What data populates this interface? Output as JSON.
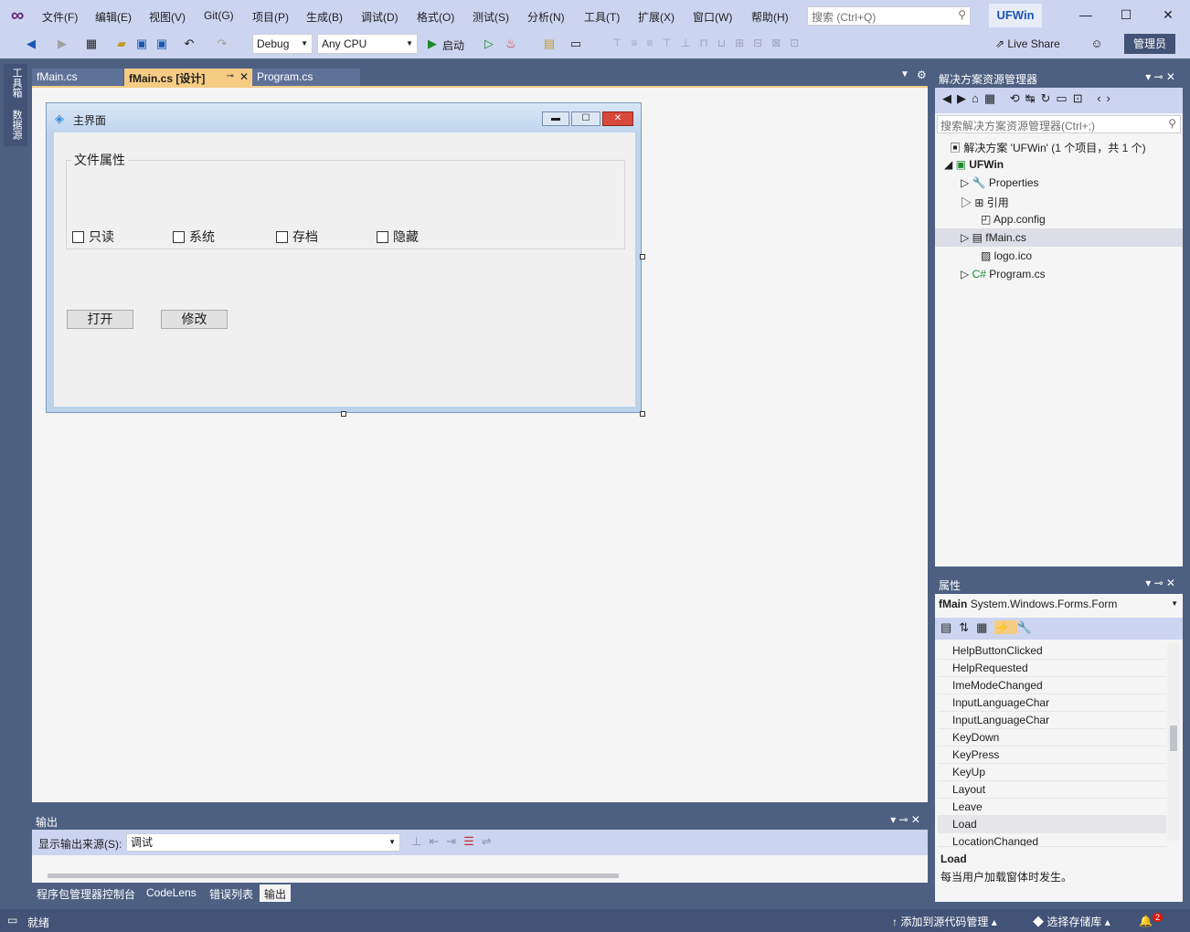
{
  "menu": [
    "文件(F)",
    "编辑(E)",
    "视图(V)",
    "Git(G)",
    "项目(P)",
    "生成(B)",
    "调试(D)",
    "格式(O)",
    "测试(S)",
    "分析(N)",
    "工具(T)",
    "扩展(X)",
    "窗口(W)",
    "帮助(H)"
  ],
  "search_placeholder": "搜索 (Ctrl+Q)",
  "app_title": "UFWin",
  "toolbar": {
    "config": "Debug",
    "platform": "Any CPU",
    "start": "启动",
    "live_share": "Live Share",
    "admin": "管理员"
  },
  "left_tabs": [
    "工具箱",
    "数据源"
  ],
  "doc_tabs": [
    "fMain.cs",
    "fMain.cs [设计]",
    "Program.cs"
  ],
  "form": {
    "title": "主界面",
    "group": "文件属性",
    "checkboxes": [
      "只读",
      "系统",
      "存档",
      "隐藏"
    ],
    "buttons": [
      "打开",
      "修改"
    ]
  },
  "solution": {
    "header": "解决方案资源管理器",
    "search": "搜索解决方案资源管理器(Ctrl+;)",
    "root": "解决方案 'UFWin' (1 个项目，共 1 个)",
    "project": "UFWin",
    "items": [
      "Properties",
      "引用",
      "App.config",
      "fMain.cs",
      "logo.ico",
      "Program.cs"
    ]
  },
  "properties": {
    "header": "属性",
    "object": "fMain",
    "type": "System.Windows.Forms.Form",
    "events": [
      "HelpButtonClicked",
      "HelpRequested",
      "ImeModeChanged",
      "InputLanguageChar",
      "InputLanguageChar",
      "KeyDown",
      "KeyPress",
      "KeyUp",
      "Layout",
      "Leave",
      "Load",
      "LocationChanged"
    ],
    "desc_title": "Load",
    "desc_text": "每当用户加载窗体时发生。"
  },
  "output": {
    "header": "输出",
    "source_label": "显示输出来源(S):",
    "source_value": "调试"
  },
  "bottom_tabs": [
    "程序包管理器控制台",
    "CodeLens",
    "错误列表",
    "输出"
  ],
  "status": {
    "ready": "就绪",
    "add_source": "添加到源代码管理",
    "select_repo": "选择存储库",
    "notif": "2"
  }
}
